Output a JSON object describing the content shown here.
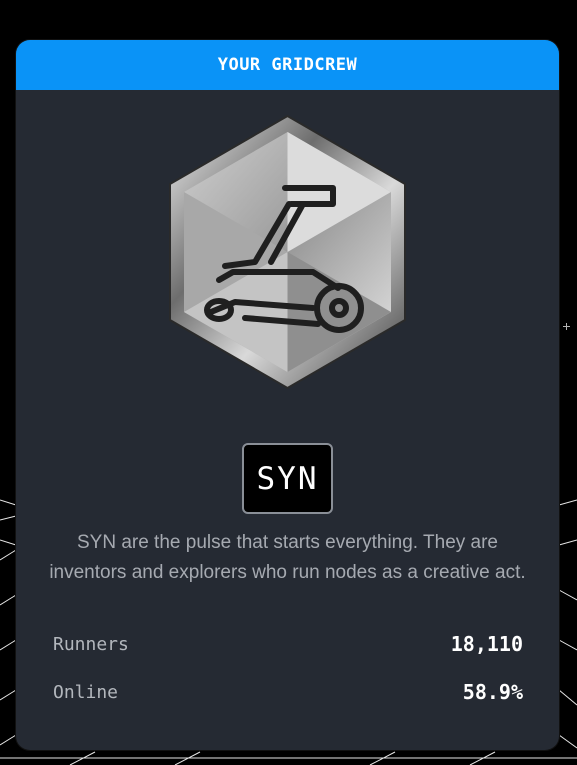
{
  "card": {
    "title": "YOUR GRIDCREW",
    "crew_code": "SYN",
    "badge_icon": "motorcycle-icon",
    "description": "SYN are the pulse that starts everything. They are inventors and explorers who run nodes as a creative act."
  },
  "stats": [
    {
      "label": "Runners",
      "value": "18,110"
    },
    {
      "label": "Online",
      "value": "58.9%"
    }
  ],
  "colors": {
    "header": "#0a93f7",
    "card_bg": "#252a33",
    "page_bg": "#000000"
  }
}
